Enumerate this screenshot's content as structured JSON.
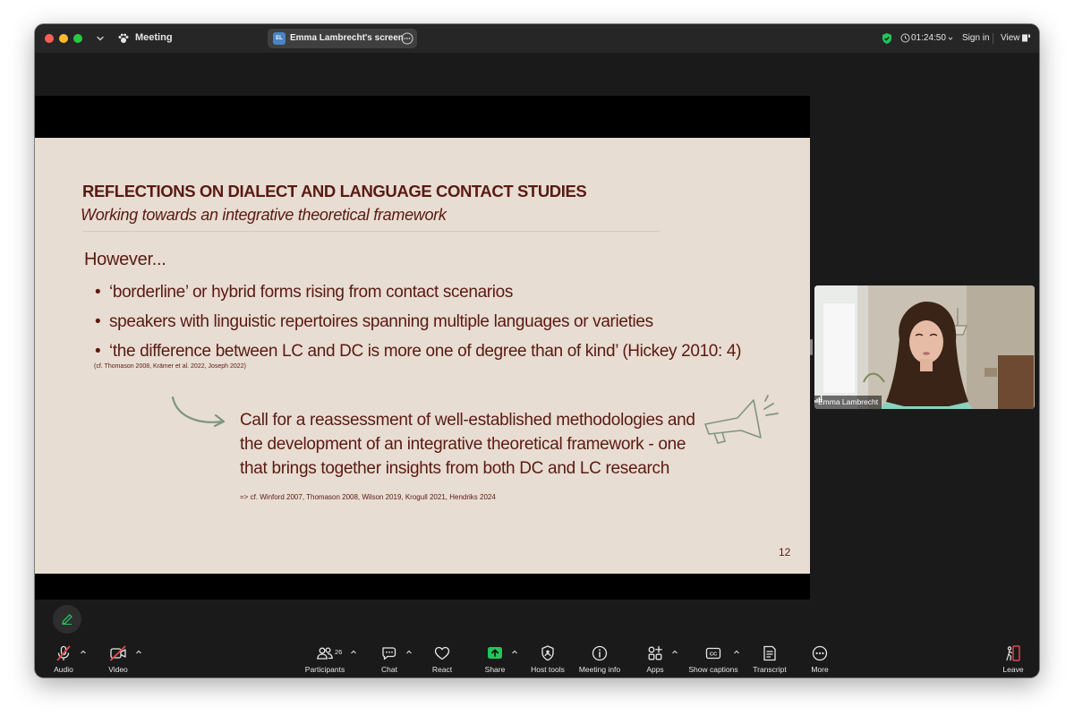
{
  "titlebar": {
    "meeting_label": "Meeting",
    "share_pill": {
      "avatar_initials": "EL",
      "label": "Emma Lambrecht's screen"
    },
    "timer": "01:24:50",
    "sign_in": "Sign in",
    "view": "View"
  },
  "slide": {
    "title": "REFLECTIONS ON DIALECT AND LANGUAGE CONTACT STUDIES",
    "subtitle": "Working towards an integrative theoretical framework",
    "intro": "However...",
    "bullets": [
      "‘borderline’ or hybrid forms rising from contact scenarios",
      "speakers with linguistic repertoires spanning multiple languages or varieties",
      "‘the difference between LC and DC is more one of degree than of kind’ (Hickey 2010: 4)"
    ],
    "bullet_citation": "(cf. Thomason 2008, Krämer et al. 2022, Joseph 2022)",
    "call_text": "Call for a reassessment of well-established methodologies and the development of an integrative theoretical framework - one that brings together insights from both DC and LC research",
    "call_citation": "=> cf. Winford 2007, Thomason 2008, Wilson 2019, Krogull 2021, Hendriks 2024",
    "page_number": "12",
    "text_color": "#5a1a12",
    "background": "#e8ddd3"
  },
  "participant": {
    "name": "Emma Lambrecht"
  },
  "toolbar": {
    "audio": "Audio",
    "video": "Video",
    "participants": "Participants",
    "participant_count": "26",
    "chat": "Chat",
    "react": "React",
    "share": "Share",
    "host_tools": "Host tools",
    "meeting_info": "Meeting info",
    "apps": "Apps",
    "show_captions": "Show captions",
    "transcript": "Transcript",
    "more": "More",
    "leave": "Leave"
  },
  "colors": {
    "accent_green": "#22c55e",
    "leave_red": "#e5484d",
    "muted_red": "#e5484d"
  }
}
